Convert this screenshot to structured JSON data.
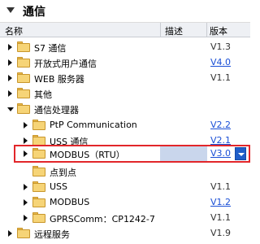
{
  "panel": {
    "title": "通信"
  },
  "columns": {
    "name": "名称",
    "description": "描述",
    "version": "版本"
  },
  "rows": [
    {
      "label": "S7 通信",
      "version": "V1.3"
    },
    {
      "label": "开放式用户通信",
      "version": "V4.0"
    },
    {
      "label": "WEB 服务器",
      "version": "V1.1"
    },
    {
      "label": "其他",
      "version": ""
    },
    {
      "label": "通信处理器",
      "version": ""
    },
    {
      "label": "PtP Communication",
      "version": "V2.2"
    },
    {
      "label": "USS 通信",
      "version": "V2.1"
    },
    {
      "label": "MODBUS（RTU）",
      "version": "V3.0"
    },
    {
      "label": "点到点",
      "version": ""
    },
    {
      "label": "USS",
      "version": "V1.1"
    },
    {
      "label": "MODBUS",
      "version": "V1.2"
    },
    {
      "label": "GPRSComm：CP1242-7",
      "version": "V1.1"
    },
    {
      "label": "远程服务",
      "version": "V1.9"
    }
  ],
  "colors": {
    "selection_border": "#e2262a",
    "link": "#1a4fd6",
    "selection_bg": "#c9d6ec"
  },
  "icons": {
    "folder": "folder-icon",
    "expand": "triangle-right-icon",
    "collapse": "triangle-down-icon"
  }
}
